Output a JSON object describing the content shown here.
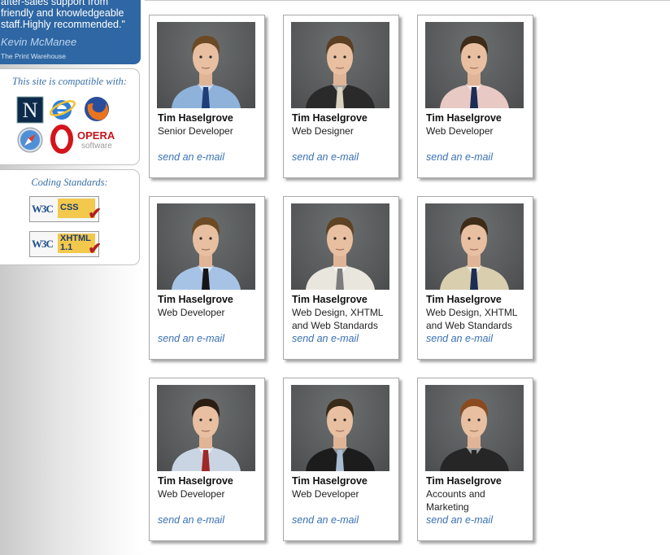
{
  "testimonial": {
    "text": "after-sales support from friendly and knowledgeable staff.Highly recommended.\"",
    "author": "Kevin McManee",
    "company": "The Print Warehouse"
  },
  "compatibility": {
    "title": "This site is compatible with:",
    "browsers": [
      "netscape-icon",
      "internet-explorer-icon",
      "firefox-icon",
      "safari-icon",
      "opera-icon"
    ],
    "opera_label": "OPERA",
    "opera_sub": "software"
  },
  "standards": {
    "title": "Coding Standards:",
    "badges": [
      {
        "org": "W3C",
        "std": "CSS"
      },
      {
        "org": "W3C",
        "std": "XHTML 1.1"
      }
    ]
  },
  "staff": [
    {
      "name": "Tim Haselgrove",
      "role": "Senior Developer",
      "link": "send an e-mail",
      "shirt": "#8fb2da",
      "tie": "#1f3e78",
      "hair": "#6b4a25"
    },
    {
      "name": "Tim Haselgrove",
      "role": "Web Designer",
      "link": "send an e-mail",
      "shirt": "#2a2a2a",
      "tie": "#d8d2bf",
      "hair": "#5a3f22"
    },
    {
      "name": "Tim Haselgrove",
      "role": "Web Developer",
      "link": "send an e-mail",
      "shirt": "#e8c9c4",
      "tie": "#1c2d55",
      "hair": "#3e2b18"
    },
    {
      "name": "Tim Haselgrove",
      "role": "Web Developer",
      "link": "send an e-mail",
      "shirt": "#a6c3e6",
      "tie": "#151515",
      "hair": "#6b4a25"
    },
    {
      "name": "Tim Haselgrove",
      "role": "Web Design, XHTML and Web Standards",
      "link": "send an e-mail",
      "shirt": "#e9e6de",
      "tie": "#7d7d7d",
      "hair": "#5e4224"
    },
    {
      "name": "Tim Haselgrove",
      "role": "Web Design, XHTML and Web Standards",
      "link": "send an e-mail",
      "shirt": "#d9cfae",
      "tie": "#1c2d55",
      "hair": "#3e2b18"
    },
    {
      "name": "Tim Haselgrove",
      "role": "Web Developer",
      "link": "send an e-mail",
      "shirt": "#c9d5e2",
      "tie": "#a02828",
      "hair": "#2c1d12"
    },
    {
      "name": "Tim Haselgrove",
      "role": "Web Developer",
      "link": "send an e-mail",
      "shirt": "#1c1c1c",
      "tie": "#a9bcd3",
      "hair": "#3a2a1a"
    },
    {
      "name": "Tim Haselgrove",
      "role": "Accounts and Marketing",
      "link": "send an e-mail",
      "shirt": "#262626",
      "tie": "#262626",
      "hair": "#8a4a20"
    }
  ]
}
